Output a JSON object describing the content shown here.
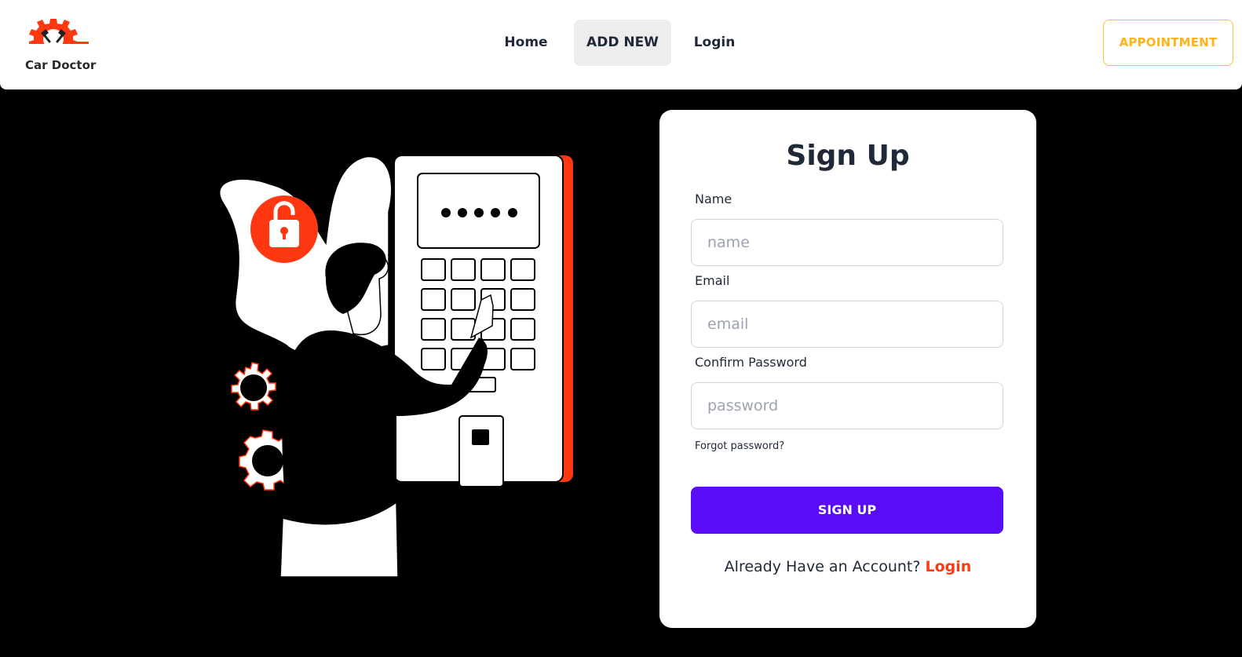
{
  "brand": {
    "name": "Car Doctor",
    "logo_icon": "gear-pistons-icon",
    "accent": "#ff3811"
  },
  "nav": {
    "home": "Home",
    "add_new": "ADD NEW",
    "login": "Login"
  },
  "appointment_label": "APPOINTMENT",
  "illustration": {
    "icon": "person-unlocking-keypad-illustration",
    "code_dots": 5
  },
  "form": {
    "title": "Sign Up",
    "name_label": "Name",
    "name_placeholder": "name",
    "email_label": "Email",
    "email_placeholder": "email",
    "password_label": "Confirm Password",
    "password_placeholder": "password",
    "forgot": "Forgot password?",
    "submit": "SIGN UP",
    "account_prompt": "Already Have an Account?",
    "account_link": "Login"
  },
  "colors": {
    "primary": "#5a0cf6",
    "accent": "#ff3811",
    "appointment": "#ffb21c",
    "page_bg": "#000000"
  }
}
